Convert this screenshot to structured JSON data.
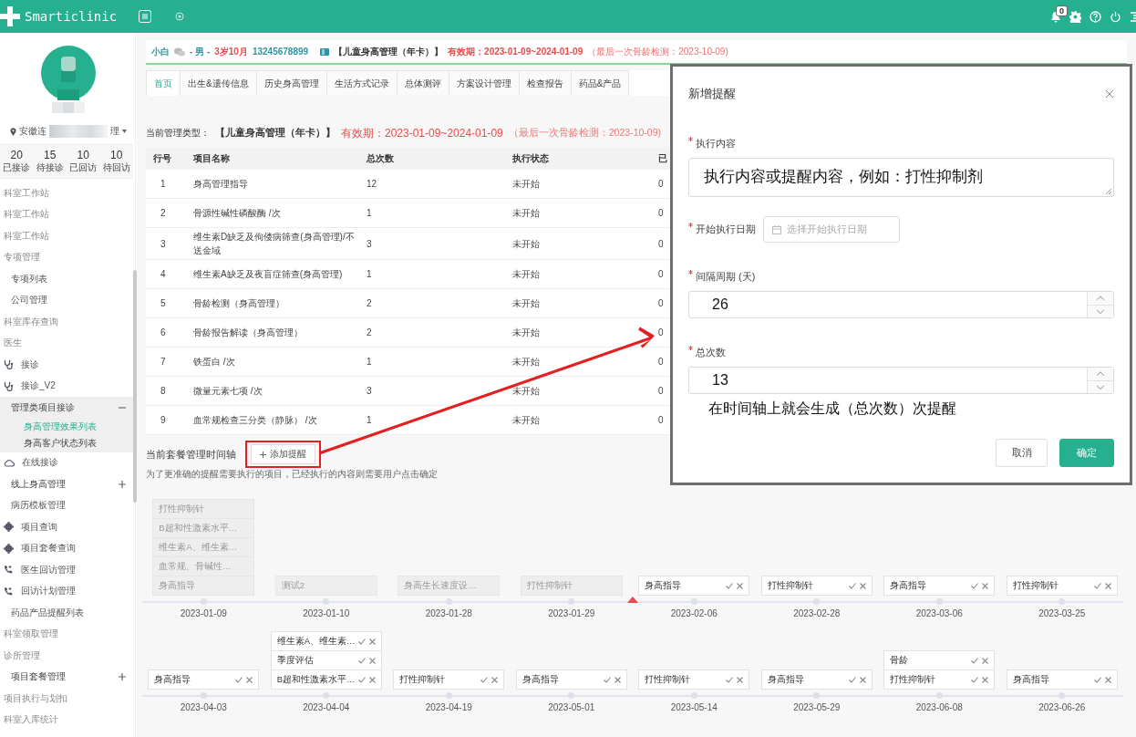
{
  "topbar": {
    "logo": "Smarticlinic",
    "notification_count": "0"
  },
  "sidebar": {
    "location_start": "安徽连",
    "location_end": "理",
    "stats": [
      {
        "value": "20",
        "label": "已接诊"
      },
      {
        "value": "15",
        "label": "待接诊"
      },
      {
        "value": "10",
        "label": "已回访"
      },
      {
        "value": "10",
        "label": "待回访"
      }
    ],
    "menu": [
      {
        "kind": "section",
        "text": "科室工作站"
      },
      {
        "kind": "section",
        "text": "科室工作站"
      },
      {
        "kind": "section",
        "text": "科室工作站"
      },
      {
        "kind": "section",
        "text": "专项管理"
      },
      {
        "kind": "link",
        "text": "专项列表"
      },
      {
        "kind": "link",
        "text": "公司管理"
      },
      {
        "kind": "section",
        "text": "科室库存查询"
      },
      {
        "kind": "section",
        "text": "医生"
      },
      {
        "kind": "icon-link",
        "text": "接诊"
      },
      {
        "kind": "icon-link",
        "text": "接诊_V2"
      },
      {
        "kind": "group",
        "text": "管理类项目接诊",
        "expanded": true,
        "children": [
          {
            "text": "身高管理效果列表",
            "selected": true
          },
          {
            "text": "身高客户状态列表",
            "selected": false
          }
        ]
      },
      {
        "kind": "icon-link",
        "text": "在线接诊"
      },
      {
        "kind": "group",
        "text": "线上身高管理",
        "expanded": false
      },
      {
        "kind": "link",
        "text": "病历模板管理"
      },
      {
        "kind": "icon-link",
        "text": "项目查询"
      },
      {
        "kind": "icon-link",
        "text": "项目套餐查询"
      },
      {
        "kind": "icon-link",
        "text": "医生回访管理"
      },
      {
        "kind": "icon-link",
        "text": "回访计划管理"
      },
      {
        "kind": "link",
        "text": "药品产品提醒列表"
      },
      {
        "kind": "section",
        "text": "科室领取管理"
      },
      {
        "kind": "section",
        "text": "诊所管理"
      },
      {
        "kind": "group",
        "text": "项目套餐管理",
        "expanded": false
      },
      {
        "kind": "section",
        "text": "项目执行与划扣"
      },
      {
        "kind": "section",
        "text": "科室入库统计"
      }
    ]
  },
  "patient": {
    "name": "小白",
    "gender": "- 男 -",
    "age": "3岁10月",
    "phone": "13245678899",
    "package": "【儿童身高管理（年卡）】",
    "validity": "有效期：2023-01-09~2024-01-09",
    "last_check": "（最后一次骨龄检测：2023-10-09)"
  },
  "tabs": [
    {
      "label": "首页",
      "selected": true
    },
    {
      "label": "出生&遗传信息",
      "selected": false
    },
    {
      "label": "历史身高管理",
      "selected": false
    },
    {
      "label": "生活方式记录",
      "selected": false
    },
    {
      "label": "总体测评",
      "selected": false
    },
    {
      "label": "方案设计管理",
      "selected": false
    },
    {
      "label": "检查报告",
      "selected": false
    },
    {
      "label": "药品&产品",
      "selected": false
    }
  ],
  "management": {
    "label": "当前管理类型：",
    "package": "【儿童身高管理（年卡）】",
    "validity": "有效期：2023-01-09~2024-01-09",
    "last_check": "（最后一次骨龄检测：2023-10-09)"
  },
  "table": {
    "columns": [
      "行号",
      "项目名称",
      "总次数",
      "执行状态",
      "已"
    ],
    "rows": [
      [
        "1",
        "身高管理指导",
        "12",
        "未开始",
        "0"
      ],
      [
        "2",
        "骨源性碱性磷酸酶 /次",
        "1",
        "未开始",
        "0"
      ],
      [
        "3",
        "维生素D缺乏及佝偻病筛查(身高管理)/不送金域",
        "3",
        "未开始",
        "0"
      ],
      [
        "4",
        "维生素A缺乏及夜盲症筛查(身高管理)",
        "1",
        "未开始",
        "0"
      ],
      [
        "5",
        "骨龄检测（身高管理）",
        "2",
        "未开始",
        "0"
      ],
      [
        "6",
        "骨龄报告解读（身高管理）",
        "2",
        "未开始",
        "0"
      ],
      [
        "7",
        "铁蛋白 /次",
        "1",
        "未开始",
        "0"
      ],
      [
        "8",
        "微量元素七项 /次",
        "3",
        "未开始",
        "0"
      ],
      [
        "9",
        "血常规检查三分类（静脉） /次",
        "1",
        "未开始",
        "0"
      ]
    ]
  },
  "timeline": {
    "title": "当前套餐管理时间轴",
    "add_button": "添加提醒",
    "note": "为了更准确的提醒需要执行的项目，已经执行的内容则需要用户点击确定",
    "rows": [
      {
        "dates": [
          {
            "date": "2023-01-09",
            "current": false,
            "items": [
              {
                "text": "打性抑制针",
                "done": true
              },
              {
                "text": "B超和性激素水平…",
                "done": true
              },
              {
                "text": "维生素A、维生素…",
                "done": true
              },
              {
                "text": "血常规、骨碱性…",
                "done": true
              },
              {
                "text": "身高指导",
                "done": true
              }
            ]
          },
          {
            "date": "2023-01-10",
            "current": false,
            "items": [
              {
                "text": "测试2",
                "done": true
              }
            ]
          },
          {
            "date": "2023-01-28",
            "current": false,
            "items": [
              {
                "text": "身高生长速度设…",
                "done": true
              }
            ]
          },
          {
            "date": "2023-01-29",
            "current": false,
            "items": [
              {
                "text": "打性抑制针",
                "done": true
              }
            ]
          },
          {
            "date": "2023-02-06",
            "current": true,
            "items": [
              {
                "text": "身高指导",
                "done": false
              }
            ]
          },
          {
            "date": "2023-02-28",
            "current": false,
            "items": [
              {
                "text": "打性抑制针",
                "done": false
              }
            ]
          },
          {
            "date": "2023-03-06",
            "current": false,
            "items": [
              {
                "text": "身高指导",
                "done": false
              }
            ]
          },
          {
            "date": "2023-03-25",
            "current": false,
            "items": [
              {
                "text": "打性抑制针",
                "done": false
              }
            ]
          }
        ]
      },
      {
        "dates": [
          {
            "date": "2023-04-03",
            "current": false,
            "items": [
              {
                "text": "身高指导",
                "done": false
              }
            ]
          },
          {
            "date": "2023-04-04",
            "current": false,
            "items": [
              {
                "text": "维生素A、维生素…",
                "done": false
              },
              {
                "text": "季度评估",
                "done": false
              },
              {
                "text": "B超和性激素水平…",
                "done": false
              }
            ]
          },
          {
            "date": "2023-04-19",
            "current": false,
            "items": [
              {
                "text": "打性抑制针",
                "done": false
              }
            ]
          },
          {
            "date": "2023-05-01",
            "current": false,
            "items": [
              {
                "text": "身高指导",
                "done": false
              }
            ]
          },
          {
            "date": "2023-05-14",
            "current": false,
            "items": [
              {
                "text": "打性抑制针",
                "done": false
              }
            ]
          },
          {
            "date": "2023-05-29",
            "current": false,
            "items": [
              {
                "text": "身高指导",
                "done": false
              }
            ]
          },
          {
            "date": "2023-06-08",
            "current": false,
            "items": [
              {
                "text": "骨龄",
                "done": false
              },
              {
                "text": "打性抑制针",
                "done": false
              }
            ]
          },
          {
            "date": "2023-06-26",
            "current": false,
            "items": [
              {
                "text": "身高指导",
                "done": false
              }
            ]
          }
        ]
      }
    ]
  },
  "modal": {
    "title": "新增提醒",
    "fields": [
      {
        "kind": "textarea",
        "label": "执行内容",
        "required": true,
        "value": "执行内容或提醒内容，例如：打性抑制剂"
      },
      {
        "kind": "date",
        "label": "开始执行日期",
        "required": true,
        "placeholder": "选择开始执行日期"
      },
      {
        "kind": "number",
        "label": "间隔周期 (天)",
        "required": true,
        "value": "26"
      },
      {
        "kind": "number",
        "label": "总次数",
        "required": true,
        "value": "13"
      }
    ],
    "note": "在时间轴上就会生成（总次数）次提醒",
    "buttons": [
      {
        "label": "取消",
        "primary": false
      },
      {
        "label": "确定",
        "primary": true
      }
    ]
  }
}
